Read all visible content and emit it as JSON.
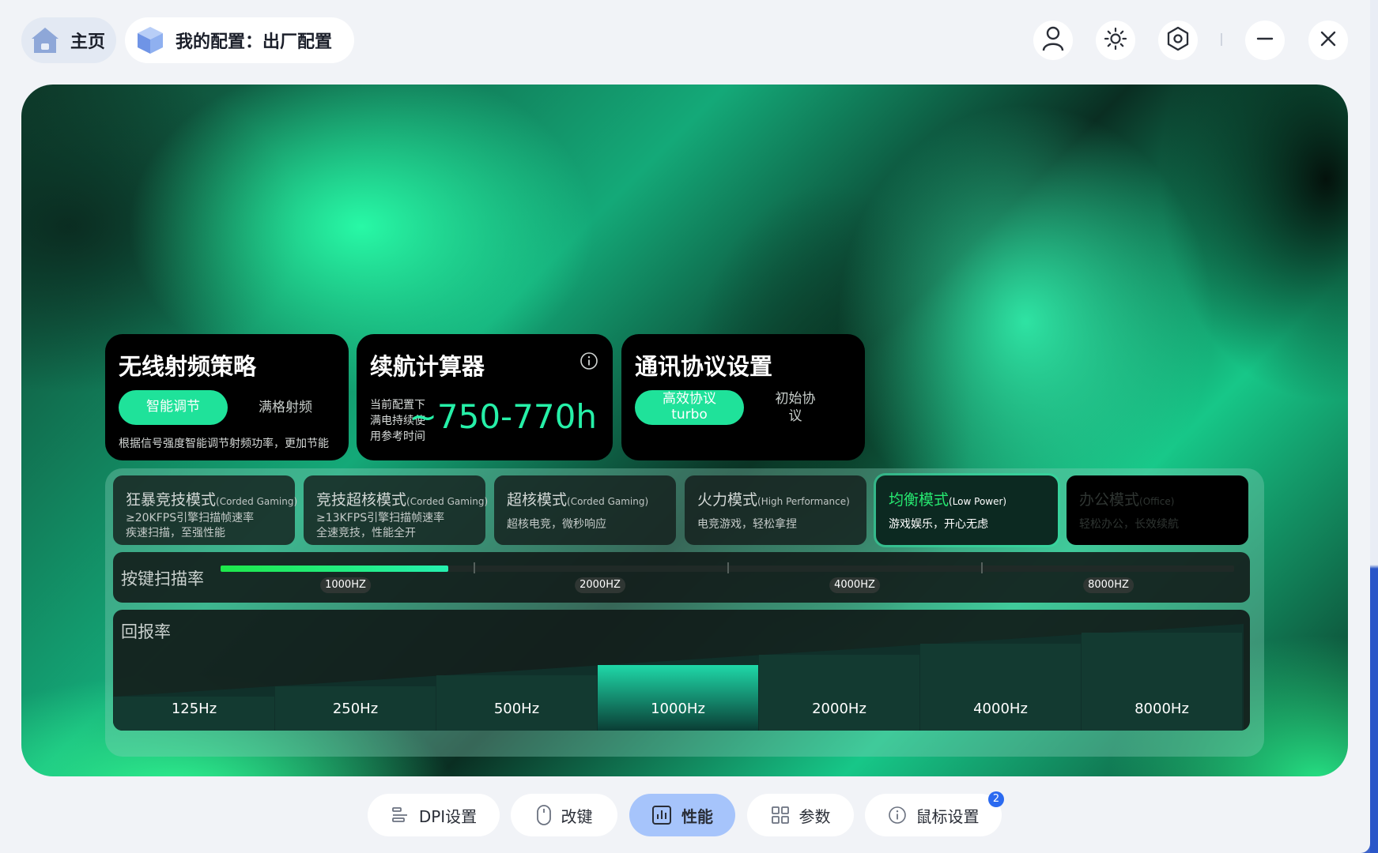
{
  "header": {
    "home_label": "主页",
    "config_label": "我的配置：出厂配置",
    "icons": [
      "home-icon",
      "cube-icon",
      "user-icon",
      "brightness-icon",
      "settings-hex-icon",
      "minimize-icon",
      "close-icon"
    ]
  },
  "cards": {
    "rf": {
      "title": "无线射频策略",
      "option_on": "智能调节",
      "option_off": "满格射频",
      "desc": "根据信号强度智能调节射频功率，更加节能"
    },
    "battery": {
      "title": "续航计算器",
      "note_line1": "当前配置下",
      "note_line2": "满电持续使",
      "note_line3": "用参考时间",
      "value": "~750-770h"
    },
    "protocol": {
      "title": "通讯协议设置",
      "option_on_line1": "高效协议",
      "option_on_line2": "turbo",
      "option_off_line1": "初始协",
      "option_off_line2": "议"
    }
  },
  "modes": [
    {
      "name": "狂暴竞技模式",
      "tag": "(Corded Gaming)",
      "line1": "≥20KFPS引擎扫描帧速率",
      "line2": "疾速扫描，至强性能"
    },
    {
      "name": "竞技超核模式",
      "tag": "(Corded Gaming)",
      "line1": "≥13KFPS引擎扫描帧速率",
      "line2": "全速竞技，性能全开"
    },
    {
      "name": "超核模式",
      "tag": "(Corded Gaming)",
      "line1": "超核电竞，微秒响应"
    },
    {
      "name": "火力模式",
      "tag": "(High Performance)",
      "line1": "电竞游戏，轻松拿捏"
    },
    {
      "name": "均衡模式",
      "tag": "(Low Power)",
      "line1": "游戏娱乐，开心无虑"
    },
    {
      "name": "办公模式",
      "tag": "(Office)",
      "line1": "轻松办公，长效续航"
    }
  ],
  "active_mode": "均衡模式",
  "scan_rate": {
    "title": "按键扫描率",
    "labels": [
      "1000HZ",
      "2000HZ",
      "4000HZ",
      "8000HZ"
    ],
    "selected": "1000HZ",
    "fill_fraction": 0.225
  },
  "report_rate": {
    "title": "回报率",
    "options": [
      "125Hz",
      "250Hz",
      "500Hz",
      "1000Hz",
      "2000Hz",
      "4000Hz",
      "8000Hz"
    ],
    "selected": "1000Hz"
  },
  "nav": {
    "dpi": "DPI设置",
    "remap": "改键",
    "perf": "性能",
    "params": "参数",
    "mouse": "鼠标设置",
    "badge": "2"
  },
  "colors": {
    "accent_green": "#1fe29a",
    "active_nav": "#a6c4fb",
    "badge_blue": "#2b6af0"
  }
}
